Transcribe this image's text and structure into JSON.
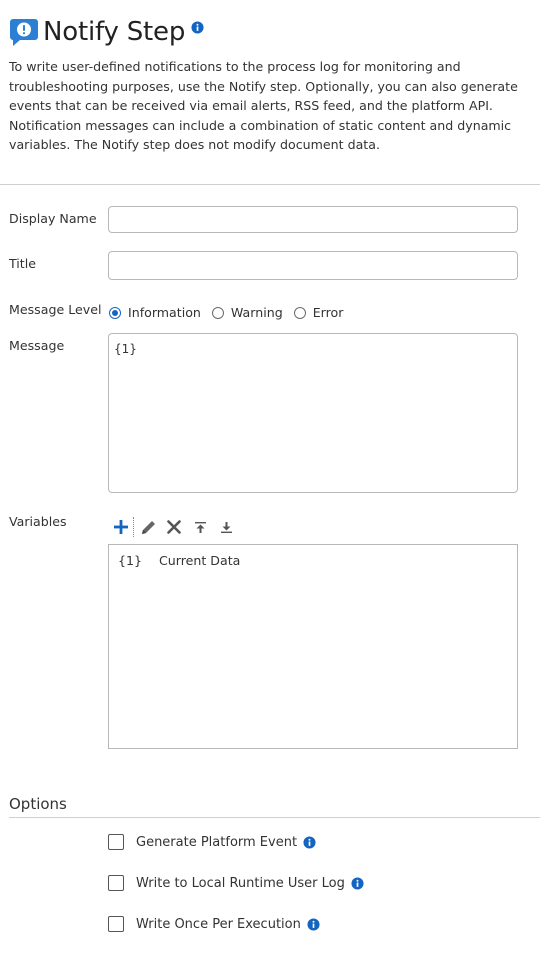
{
  "header": {
    "title": "Notify Step",
    "icon": "speech-bubble-exclamation-icon",
    "icon_color": "#2d7fd3"
  },
  "description": "To write user-defined notifications to the process log for monitoring and troubleshooting purposes, use the Notify step. Optionally, you can also generate events that can be received via email alerts, RSS feed, and the platform API. Notification messages can include a combination of static content and dynamic variables. The Notify step does not modify document data.",
  "form": {
    "display_name": {
      "label": "Display Name",
      "value": ""
    },
    "title": {
      "label": "Title",
      "value": ""
    },
    "message_level": {
      "label": "Message Level",
      "options": [
        "Information",
        "Warning",
        "Error"
      ],
      "selected": "Information"
    },
    "message": {
      "label": "Message",
      "value": "{1}"
    },
    "variables": {
      "label": "Variables",
      "toolbar": [
        "add-icon",
        "edit-icon",
        "delete-icon",
        "move-up-icon",
        "move-down-icon"
      ],
      "items": [
        {
          "key": "{1}",
          "value": "Current Data"
        }
      ]
    }
  },
  "options": {
    "title": "Options",
    "checkboxes": [
      {
        "label": "Generate Platform Event",
        "checked": false
      },
      {
        "label": "Write to Local Runtime User Log",
        "checked": false
      },
      {
        "label": "Write Once Per Execution",
        "checked": false
      }
    ]
  },
  "colors": {
    "accent": "#1565c0",
    "info": "#1565c0"
  }
}
